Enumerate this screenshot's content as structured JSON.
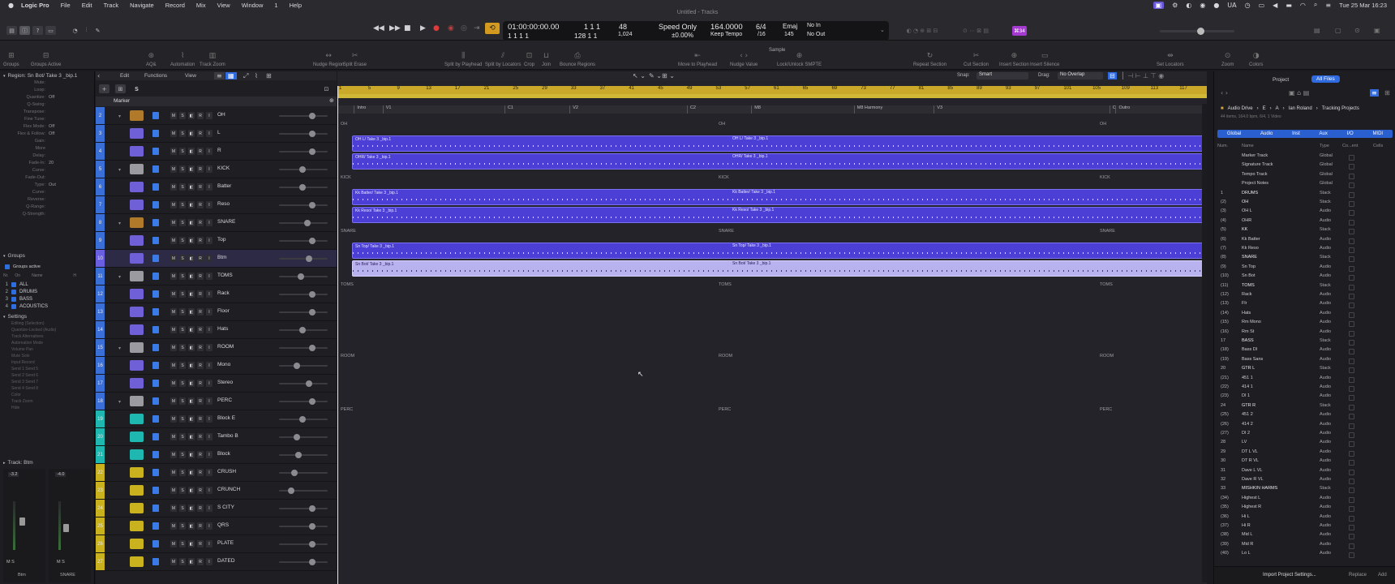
{
  "menubar": {
    "app": "Logic Pro",
    "items": [
      "File",
      "Edit",
      "Track",
      "Navigate",
      "Record",
      "Mix",
      "View",
      "Window",
      "1",
      "Help"
    ],
    "datetime": "Tue 25 Mar  16:23"
  },
  "window": {
    "title": "Untitled - Tracks"
  },
  "lcd": {
    "time": "01:00:00:00.00",
    "sub_time": "1  1  1     1",
    "bars": "1  1  1",
    "bars_sub": "128  1  1",
    "beat_a": "48",
    "beat_b": "1,024",
    "mode": "Speed Only",
    "delta": "±0.00%",
    "tempo": "164.0000",
    "tempo_mode": "Keep Tempo",
    "sig": "6/4",
    "sig_div": "/16",
    "key": "Emaj",
    "key_sub": "145",
    "in": "No In",
    "out": "No Out"
  },
  "cpu_badge": "⌘34",
  "toolbar": {
    "items": [
      "Groups",
      "Groups Active",
      "AQ&",
      "Automation",
      "Track Zoom",
      "Nudge Region",
      "Split Erase",
      "Split by Playhead",
      "Split by Locators",
      "Crop",
      "Join",
      "Bounce Regions",
      "Move to Playhead",
      "Nudge Value",
      "Lock/Unlock SMPTE",
      "Repeat Section",
      "Cut Section",
      "Insert Section",
      "Insert Silence",
      "Set Locators",
      "Zoom",
      "Colors"
    ],
    "nudge_value": "Sample"
  },
  "inspector": {
    "region": "Region:  Sn Bot/ Take 3 _bip.1",
    "params": [
      {
        "k": "Mute:",
        "v": ""
      },
      {
        "k": "Loop:",
        "v": ""
      },
      {
        "k": "Quantize:",
        "v": "Off"
      },
      {
        "k": "Q-Swing:",
        "v": ""
      },
      {
        "k": "Transpose:",
        "v": ""
      },
      {
        "k": "Fine Tune:",
        "v": ""
      },
      {
        "k": "Flex Mode:",
        "v": "Off"
      },
      {
        "k": "Flex & Follow:",
        "v": "Off"
      },
      {
        "k": "Gain:",
        "v": ""
      },
      {
        "k": "More",
        "v": ""
      },
      {
        "k": "Delay:",
        "v": ""
      },
      {
        "k": "Fade-In:",
        "v": "20"
      },
      {
        "k": "Curve:",
        "v": ""
      },
      {
        "k": "Fade-Out:",
        "v": ""
      },
      {
        "k": "Type:",
        "v": "Out"
      },
      {
        "k": "Curve:",
        "v": ""
      },
      {
        "k": "Reverse:",
        "v": ""
      },
      {
        "k": "Q-Range:",
        "v": ""
      },
      {
        "k": "Q-Strength:",
        "v": ""
      }
    ],
    "groups_title": "Groups",
    "groups_active": "Groups active",
    "group_cols": [
      "Nr.",
      "On",
      "Name",
      "H"
    ],
    "groups": [
      {
        "n": "1",
        "name": "ALL"
      },
      {
        "n": "2",
        "name": "DRUMS"
      },
      {
        "n": "3",
        "name": "BASS"
      },
      {
        "n": "4",
        "name": "ACOUSTICS"
      }
    ],
    "settings_title": "Settings",
    "settings": [
      "Editing (Selection)",
      "Quantize-Locked (Audio)",
      "Track Alternatives",
      "Automation Mode",
      "Volume        Pan",
      "Mute           Solo",
      "Input           Record",
      "Send 1       Send 5",
      "Send 2       Send 6",
      "Send 3       Send 7",
      "Send 4       Send 8",
      "Color",
      "Track Zoom",
      "Hide"
    ],
    "track_label": "Track:  Btm",
    "strip_a": {
      "val": "-3.2",
      "name": "Btm"
    },
    "strip_b": {
      "val": "-4.0",
      "name": "SNARE"
    }
  },
  "trackhdr": {
    "edit": "Edit",
    "functions": "Functions",
    "view": "View",
    "marker": "Marker"
  },
  "tracks": [
    {
      "n": "2",
      "name": "OH",
      "color": "#3a6fd8",
      "icon": "#b07a2a",
      "folder": true
    },
    {
      "n": "3",
      "name": "L",
      "color": "#3a6fd8",
      "icon": "#7060d8"
    },
    {
      "n": "4",
      "name": "R",
      "color": "#3a6fd8",
      "icon": "#7060d8"
    },
    {
      "n": "5",
      "name": "KICK",
      "color": "#3a6fd8",
      "icon": "#9a9aa0",
      "folder": true
    },
    {
      "n": "6",
      "name": "Batter",
      "color": "#3a6fd8",
      "icon": "#7060d8"
    },
    {
      "n": "7",
      "name": "Reso",
      "color": "#3a6fd8",
      "icon": "#7060d8"
    },
    {
      "n": "8",
      "name": "SNARE",
      "color": "#3a6fd8",
      "icon": "#b07a2a",
      "folder": true
    },
    {
      "n": "9",
      "name": "Top",
      "color": "#3a6fd8",
      "icon": "#7060d8"
    },
    {
      "n": "10",
      "name": "Btm",
      "color": "#6a5fe0",
      "icon": "#7060d8"
    },
    {
      "n": "11",
      "name": "TOMS",
      "color": "#3a6fd8",
      "icon": "#9a9aa0",
      "folder": true
    },
    {
      "n": "12",
      "name": "Rack",
      "color": "#3a6fd8",
      "icon": "#7060d8"
    },
    {
      "n": "13",
      "name": "Floor",
      "color": "#3a6fd8",
      "icon": "#7060d8"
    },
    {
      "n": "14",
      "name": "Hats",
      "color": "#3a6fd8",
      "icon": "#7060d8"
    },
    {
      "n": "15",
      "name": "ROOM",
      "color": "#3a6fd8",
      "icon": "#9a9aa0",
      "folder": true
    },
    {
      "n": "16",
      "name": "Mono",
      "color": "#3a6fd8",
      "icon": "#7060d8"
    },
    {
      "n": "17",
      "name": "Stereo",
      "color": "#3a6fd8",
      "icon": "#7060d8"
    },
    {
      "n": "18",
      "name": "PERC",
      "color": "#3a6fd8",
      "icon": "#9a9aa0",
      "folder": true
    },
    {
      "n": "19",
      "name": "Block  E",
      "color": "#1fb8b0",
      "icon": "#1fb8b0"
    },
    {
      "n": "20",
      "name": "Tambo  B",
      "color": "#1fb8b0",
      "icon": "#1fb8b0"
    },
    {
      "n": "21",
      "name": "Block",
      "color": "#1fb8b0",
      "icon": "#1fb8b0"
    },
    {
      "n": "22",
      "name": "CRUSH",
      "color": "#c9b21e",
      "icon": "#c9b21e"
    },
    {
      "n": "23",
      "name": "CRUNCH",
      "color": "#c9b21e",
      "icon": "#c9b21e"
    },
    {
      "n": "24",
      "name": "S CITY",
      "color": "#c9b21e",
      "icon": "#c9b21e"
    },
    {
      "n": "25",
      "name": "QRS",
      "color": "#c9b21e",
      "icon": "#c9b21e"
    },
    {
      "n": "26",
      "name": "PLATE",
      "color": "#c9b21e",
      "icon": "#c9b21e"
    },
    {
      "n": "27",
      "name": "DATED",
      "color": "#c9b21e",
      "icon": "#c9b21e"
    }
  ],
  "fader_levels": [
    0.62,
    0.62,
    0.62,
    0.42,
    0.42,
    0.62,
    0.52,
    0.62,
    0.55,
    0.38,
    0.62,
    0.62,
    0.42,
    0.62,
    0.3,
    0.55,
    0.62,
    0.42,
    0.3,
    0.33,
    0.25,
    0.18,
    0.62,
    0.62,
    0.62,
    0.62
  ],
  "ruler": {
    "ticks": [
      "1",
      "5",
      "9",
      "13",
      "17",
      "21",
      "25",
      "29",
      "33",
      "37",
      "41",
      "45",
      "49",
      "53",
      "57",
      "61",
      "65",
      "69",
      "73",
      "77",
      "81",
      "85",
      "89",
      "93",
      "97",
      "101",
      "105",
      "109",
      "113",
      "117"
    ]
  },
  "markers": [
    {
      "label": "Intro",
      "x": 0.019
    },
    {
      "label": "V1",
      "x": 0.052
    },
    {
      "label": "C1",
      "x": 0.192
    },
    {
      "label": "V2",
      "x": 0.267
    },
    {
      "label": "C2",
      "x": 0.402
    },
    {
      "label": "M8",
      "x": 0.476
    },
    {
      "label": "M8 Harmony",
      "x": 0.594
    },
    {
      "label": "V3",
      "x": 0.686
    },
    {
      "label": "C",
      "x": 0.888
    },
    {
      "label": "Outro",
      "x": 0.895
    }
  ],
  "folder_labels": {
    "oh": "OH",
    "kick": "KICK",
    "snare": "SNARE",
    "toms": "TOMS",
    "room": "ROOM",
    "perc": "PERC"
  },
  "regions": [
    {
      "lane": 1,
      "label": "OH L/ Take 3 _bip.1"
    },
    {
      "lane": 2,
      "label": "OHR/ Take 3 _bip.1"
    },
    {
      "lane": 4,
      "label": "Kk Batter/ Take 3 _bip.1"
    },
    {
      "lane": 5,
      "label": "Kk Reso/ Take 3 _bip.1"
    },
    {
      "lane": 7,
      "label": "Sn Top/ Take 3 _bip.1"
    },
    {
      "lane": 8,
      "label": "Sn Bot/ Take 3 _bip.1",
      "selected": true
    }
  ],
  "snap": {
    "label": "Snap:",
    "value": "Smart"
  },
  "drag": {
    "label": "Drag:",
    "value": "No Overlap"
  },
  "browser": {
    "tabs": [
      "Project",
      "All Files"
    ],
    "path": [
      "Audio Drive",
      "E",
      "A",
      "Ian Roland",
      "Tracking Projects"
    ],
    "info": "44 items, 164.0 bpm, 6/4, 1 Video",
    "filters": [
      "Global",
      "Audio",
      "Inst",
      "Aux",
      "I/O",
      "MIDI"
    ],
    "cols": [
      "Num.",
      "Name",
      "Type",
      "Co...ent",
      "Cells"
    ],
    "rows": [
      {
        "n": "",
        "name": "Marker Track",
        "type": "Global"
      },
      {
        "n": "",
        "name": "Signature Track",
        "type": "Global"
      },
      {
        "n": "",
        "name": "Tempo Track",
        "type": "Global"
      },
      {
        "n": "",
        "name": "Project Notes",
        "type": "Global"
      },
      {
        "n": "1",
        "name": "DRUMS",
        "type": "Stack"
      },
      {
        "n": "(2)",
        "name": "OH",
        "type": "Stack"
      },
      {
        "n": "(3)",
        "name": "OH L",
        "type": "Audio"
      },
      {
        "n": "(4)",
        "name": "OHR",
        "type": "Audio"
      },
      {
        "n": "(5)",
        "name": "KK",
        "type": "Stack"
      },
      {
        "n": "(6)",
        "name": "Kk Batter",
        "type": "Audio"
      },
      {
        "n": "(7)",
        "name": "Kk Reso",
        "type": "Audio"
      },
      {
        "n": "(8)",
        "name": "SNARE",
        "type": "Stack"
      },
      {
        "n": "(9)",
        "name": "Sn Top",
        "type": "Audio"
      },
      {
        "n": "(10)",
        "name": "Sn Bot",
        "type": "Audio"
      },
      {
        "n": "(11)",
        "name": "TOMS",
        "type": "Stack"
      },
      {
        "n": "(12)",
        "name": "Rack",
        "type": "Audio"
      },
      {
        "n": "(13)",
        "name": "Flr",
        "type": "Audio"
      },
      {
        "n": "(14)",
        "name": "Hats",
        "type": "Audio"
      },
      {
        "n": "(15)",
        "name": "Rm Mono",
        "type": "Audio"
      },
      {
        "n": "(16)",
        "name": "Rm St",
        "type": "Audio"
      },
      {
        "n": "17",
        "name": "BASS",
        "type": "Stack"
      },
      {
        "n": "(18)",
        "name": "Bass DI",
        "type": "Audio"
      },
      {
        "n": "(19)",
        "name": "Bass Sans",
        "type": "Audio"
      },
      {
        "n": "20",
        "name": "GTR L",
        "type": "Stack"
      },
      {
        "n": "(21)",
        "name": "451 1",
        "type": "Audio"
      },
      {
        "n": "(22)",
        "name": "414 1",
        "type": "Audio"
      },
      {
        "n": "(23)",
        "name": "DI 1",
        "type": "Audio"
      },
      {
        "n": "24",
        "name": "GTR R",
        "type": "Stack"
      },
      {
        "n": "(25)",
        "name": "451 2",
        "type": "Audio"
      },
      {
        "n": "(26)",
        "name": "414 2",
        "type": "Audio"
      },
      {
        "n": "(27)",
        "name": "DI 2",
        "type": "Audio"
      },
      {
        "n": "28",
        "name": "LV",
        "type": "Audio"
      },
      {
        "n": "29",
        "name": "DT L VL",
        "type": "Audio"
      },
      {
        "n": "30",
        "name": "DT R VL",
        "type": "Audio"
      },
      {
        "n": "31",
        "name": "Dave L VL",
        "type": "Audio"
      },
      {
        "n": "32",
        "name": "Dave R VL",
        "type": "Audio"
      },
      {
        "n": "33",
        "name": "MISHKIN HARMS",
        "type": "Stack"
      },
      {
        "n": "(34)",
        "name": "Highest L",
        "type": "Audio"
      },
      {
        "n": "(35)",
        "name": "Highest R",
        "type": "Audio"
      },
      {
        "n": "(36)",
        "name": "Hi L",
        "type": "Audio"
      },
      {
        "n": "(37)",
        "name": "Hi R",
        "type": "Audio"
      },
      {
        "n": "(38)",
        "name": "Mid L",
        "type": "Audio"
      },
      {
        "n": "(39)",
        "name": "Mid R",
        "type": "Audio"
      },
      {
        "n": "(40)",
        "name": "Lo L",
        "type": "Audio"
      }
    ],
    "footer": [
      "Import Project Settings...",
      "Replace",
      "Add"
    ]
  }
}
